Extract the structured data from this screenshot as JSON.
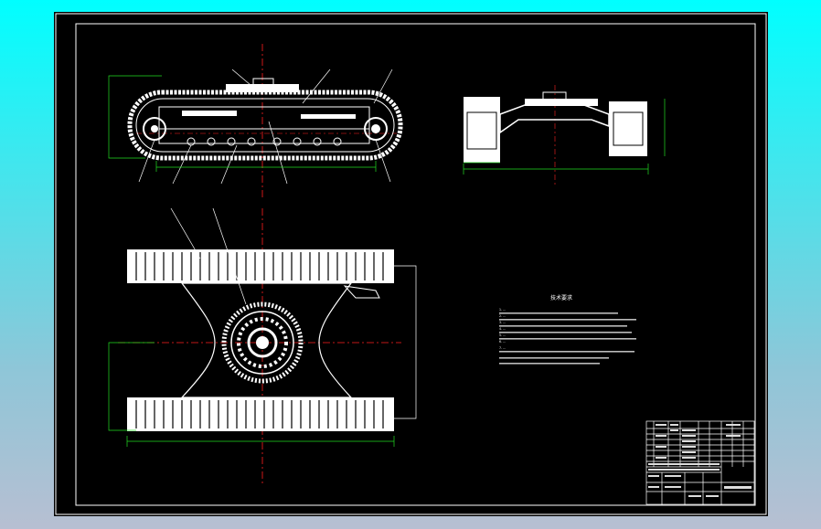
{
  "drawing": {
    "colors": {
      "background": "#000000",
      "outline": "#ffffff",
      "centerline": "#ff2020",
      "dimension": "#22dd22"
    },
    "notes": {
      "heading": "技术要求",
      "lines": [
        "1. ...",
        "2. ...",
        "3. ...",
        "4. ...",
        "5. ...",
        "6. ...",
        "7. ..."
      ]
    },
    "title_block": {
      "title": "",
      "cells": []
    }
  }
}
